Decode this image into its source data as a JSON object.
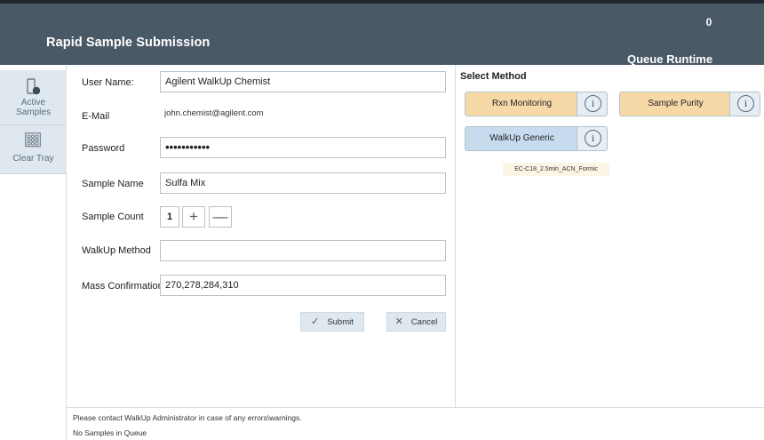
{
  "header": {
    "app_title": "Rapid Sample Submission",
    "queue_count": "0",
    "queue_label": "Queue Runtime",
    "background_color": "#4a5966"
  },
  "sidebar": {
    "items": [
      {
        "label_line1": "Active",
        "label_line2": "Samples",
        "icon": "vial-icon"
      },
      {
        "label": "Clear Tray",
        "icon": "tray-grid-icon"
      }
    ]
  },
  "form": {
    "user_name": {
      "label": "User Name:",
      "value": "Agilent WalkUp Chemist"
    },
    "email": {
      "label": "E-Mail",
      "value": "john.chemist@agilent.com"
    },
    "password": {
      "label": "Password",
      "value": "•••••••••••"
    },
    "sample_name": {
      "label": "Sample Name",
      "value": "Sulfa Mix"
    },
    "sample_count": {
      "label": "Sample Count",
      "value": "1",
      "plus": "+",
      "minus": "—"
    },
    "walkup_method": {
      "label": "WalkUp Method",
      "value": ""
    },
    "mass_confirmation": {
      "label": "Mass Confirmation",
      "value": "270,278,284,310"
    },
    "submit_label": "Submit",
    "submit_mark": "✓",
    "cancel_label": "Cancel",
    "cancel_mark": "✕"
  },
  "methods": {
    "title": "Select Method",
    "buttons": [
      {
        "label": "Rxn Monitoring",
        "color": "#f7d9a8",
        "info": "i"
      },
      {
        "label": "Sample Purity",
        "color": "#f7d9a8",
        "info": "i"
      },
      {
        "label": "WalkUp Generic",
        "color": "#c6dbee",
        "info": "i",
        "subtitle": "EC-C18_2.5min_ACN_Formic"
      }
    ]
  },
  "status": {
    "message": "Please contact WalkUp Administrator in case of any errors\\warnings.",
    "queue_status": "No Samples in Queue"
  }
}
